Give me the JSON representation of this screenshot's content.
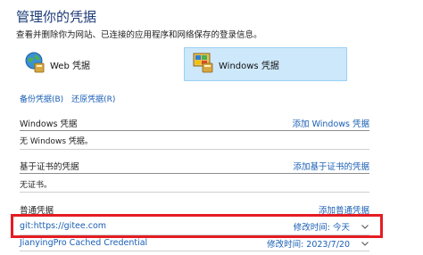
{
  "page": {
    "title": "管理你的凭据",
    "description": "查看并删除你为网站、已连接的应用程序和网络保存的登录信息。"
  },
  "tabs": [
    {
      "label": "Web 凭据",
      "icon": "web-credentials-icon",
      "selected": false
    },
    {
      "label": "Windows 凭据",
      "icon": "windows-credentials-icon",
      "selected": true
    }
  ],
  "actions": {
    "backup": "备份凭据(B)",
    "restore": "还原凭据(R)"
  },
  "sections": {
    "windows": {
      "title": "Windows 凭据",
      "add": "添加 Windows 凭据",
      "empty": "无 Windows 凭据。"
    },
    "certificate": {
      "title": "基于证书的凭据",
      "add": "添加基于证书的凭据",
      "empty": "无证书。"
    },
    "generic": {
      "title": "普通凭据",
      "add": "添加普通凭据",
      "items": [
        {
          "name": "git:https://gitee.com",
          "modified": "修改时间:  今天"
        },
        {
          "name": "JianyingPro Cached Credential",
          "modified": "修改时间:  2023/7/20"
        }
      ]
    }
  },
  "colors": {
    "title": "#1e3c78",
    "link": "#1a5fb4",
    "selected_tab_bg": "#cde8fa",
    "highlight": "#e51c23"
  }
}
